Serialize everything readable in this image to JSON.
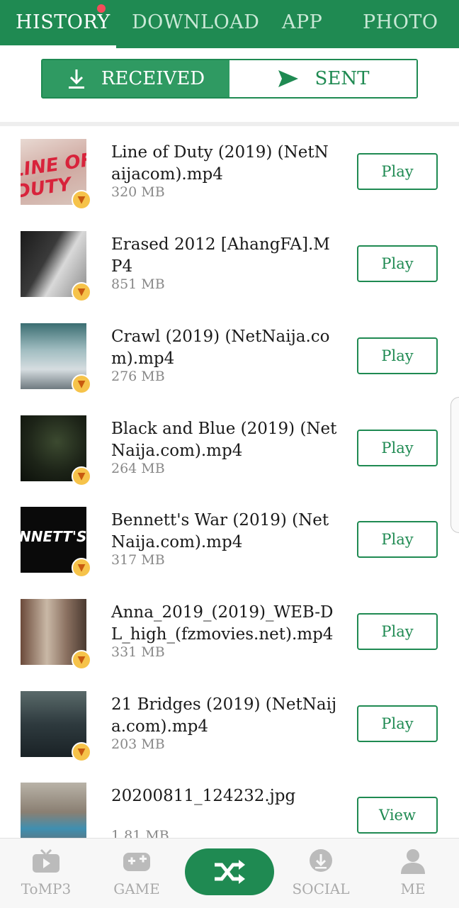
{
  "top_tabs": [
    "HISTORY",
    "DOWNLOAD",
    "APP",
    "PHOTO"
  ],
  "segment": {
    "received": "RECEIVED",
    "sent": "SENT"
  },
  "files": [
    {
      "title": "Line of Duty (2019) (NetNaijacom).mp4",
      "size": "320 MB",
      "action": "Play"
    },
    {
      "title": "Erased 2012 [AhangFA].MP4",
      "size": "851 MB",
      "action": "Play"
    },
    {
      "title": "Crawl (2019) (NetNaija.com).mp4",
      "size": "276 MB",
      "action": "Play"
    },
    {
      "title": "Black and Blue (2019) (NetNaija.com).mp4",
      "size": "264 MB",
      "action": "Play"
    },
    {
      "title": "Bennett's War (2019) (NetNaija.com).mp4",
      "size": "317 MB",
      "action": "Play"
    },
    {
      "title": "Anna_2019_(2019)_WEB-DL_high_(fzmovies.net).mp4",
      "size": "331 MB",
      "action": "Play"
    },
    {
      "title": "21 Bridges (2019) (NetNaija.com).mp4",
      "size": "203 MB",
      "action": "Play"
    },
    {
      "title": "20200811_124232.jpg",
      "size": "1.81 MB",
      "action": "View"
    }
  ],
  "thumb_texts": {
    "line_of_duty": "LINE OF DUTY",
    "bennetts_war": "NNETT'S W"
  },
  "bottom_nav": [
    "ToMP3",
    "GAME",
    "SOCIAL",
    "ME"
  ],
  "colors": {
    "brand": "#1f8a52",
    "notification": "#f44c5a"
  }
}
